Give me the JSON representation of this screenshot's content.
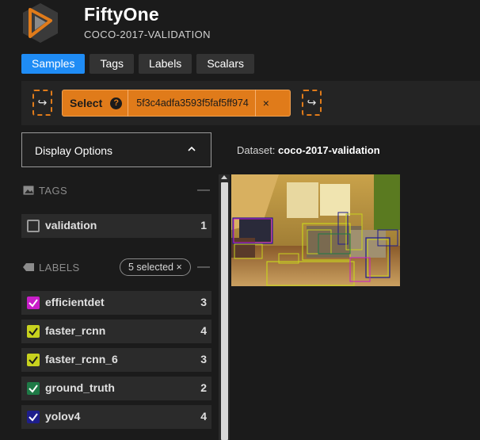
{
  "app": {
    "title": "FiftyOne",
    "subtitle": "COCO-2017-VALIDATION"
  },
  "tabs": [
    {
      "label": "Samples",
      "active": true
    },
    {
      "label": "Tags",
      "active": false
    },
    {
      "label": "Labels",
      "active": false
    },
    {
      "label": "Scalars",
      "active": false
    }
  ],
  "select_bar": {
    "select_label": "Select",
    "help_icon_text": "?",
    "sample_id": "5f3c4adfa3593f5faf5ff974",
    "close_glyph": "×",
    "left_arrow_glyph": "↪",
    "right_arrow_glyph": "↪"
  },
  "display_options": {
    "label": "Display Options",
    "chevron": "^"
  },
  "dataset": {
    "prefix": "Dataset:",
    "name": "coco-2017-validation"
  },
  "tags_section": {
    "title": "TAGS",
    "collapse_glyph": "—",
    "items": [
      {
        "label": "validation",
        "count": "1",
        "checked": false
      }
    ]
  },
  "labels_section": {
    "title": "LABELS",
    "selected_badge": "5 selected ×",
    "collapse_glyph": "—",
    "items": [
      {
        "label": "efficientdet",
        "count": "3",
        "checked": true,
        "color": "#c81ec8"
      },
      {
        "label": "faster_rcnn",
        "count": "4",
        "checked": true,
        "color": "#c8d21e"
      },
      {
        "label": "faster_rcnn_6",
        "count": "3",
        "checked": true,
        "color": "#c8d21e"
      },
      {
        "label": "ground_truth",
        "count": "2",
        "checked": true,
        "color": "#1e7a46"
      },
      {
        "label": "yolov4",
        "count": "4",
        "checked": true,
        "color": "#1e1e8c"
      }
    ]
  },
  "colors": {
    "accent_blue": "#1f8cf5",
    "select_orange": "#e07b1a",
    "background": "#1b1b1b"
  },
  "icons": {
    "logo": "fiftyone-logo",
    "tags": "image-icon",
    "labels": "label-tag-icon",
    "help": "help-icon",
    "close": "close-icon",
    "chevron": "chevron-up-icon"
  }
}
